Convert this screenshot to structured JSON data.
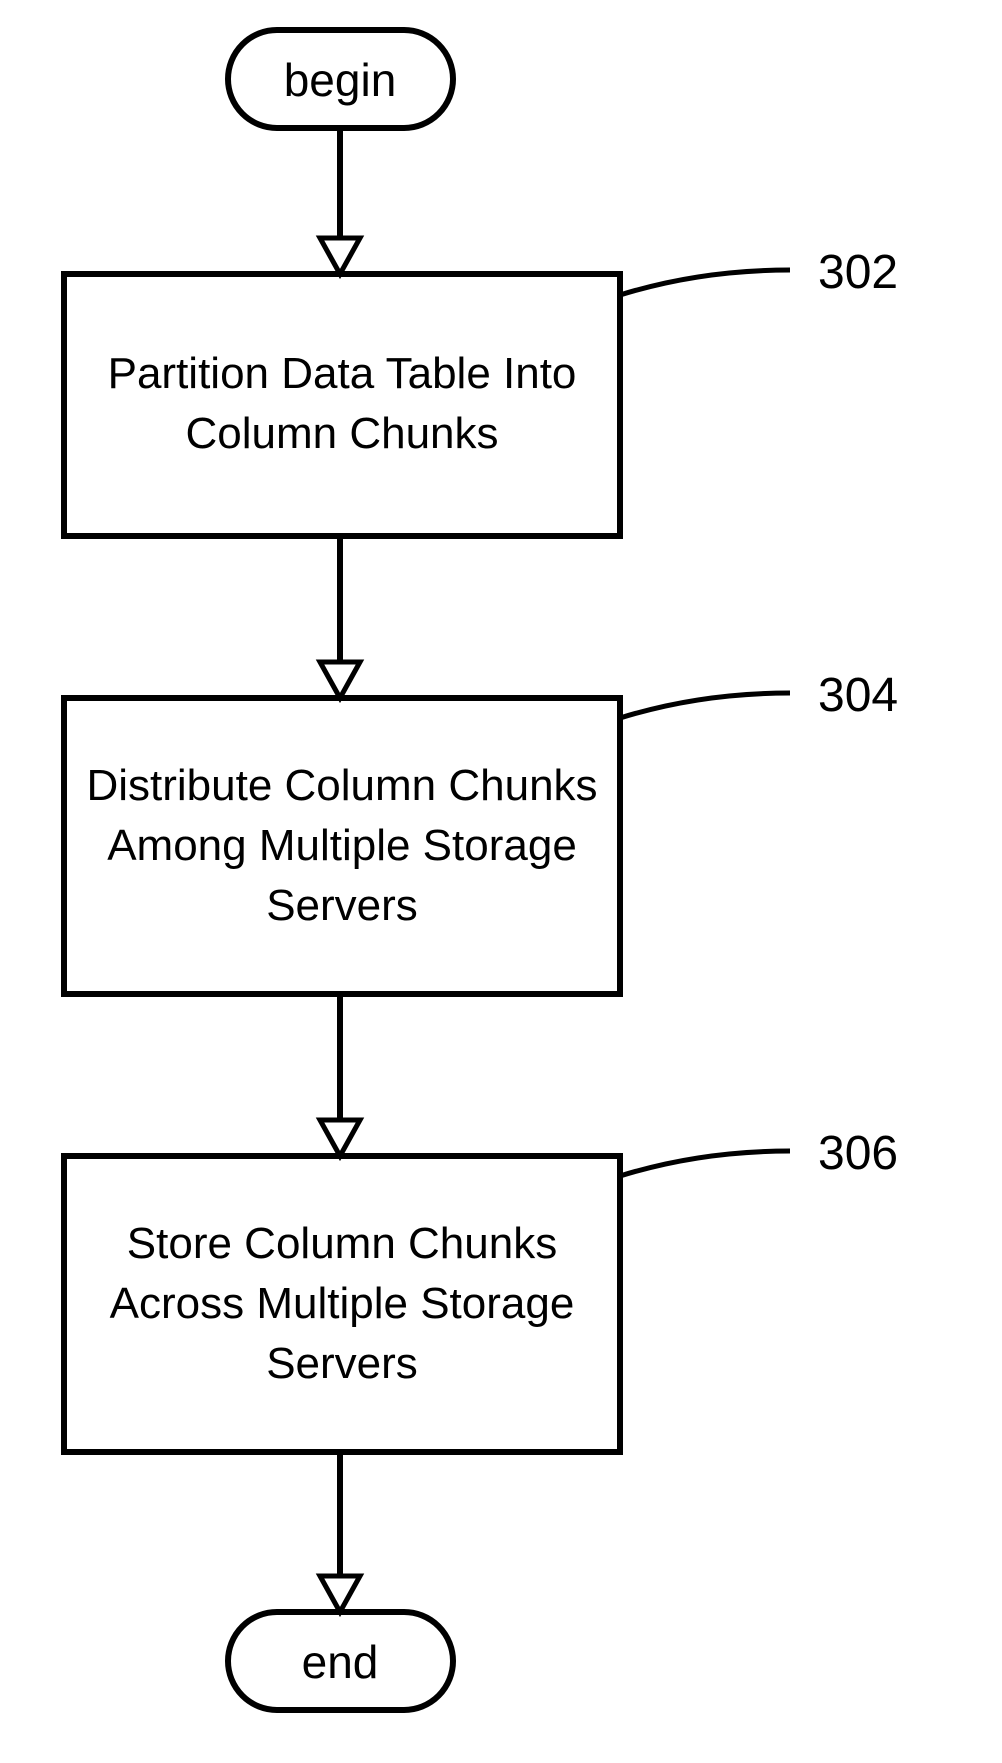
{
  "flow": {
    "start": "begin",
    "end": "end",
    "steps": [
      {
        "ref": "302",
        "lines": [
          "Partition Data Table Into",
          "Column Chunks"
        ]
      },
      {
        "ref": "304",
        "lines": [
          "Distribute Column Chunks",
          "Among Multiple Storage",
          "Servers"
        ]
      },
      {
        "ref": "306",
        "lines": [
          "Store Column Chunks",
          "Across Multiple Storage",
          "Servers"
        ]
      }
    ]
  }
}
